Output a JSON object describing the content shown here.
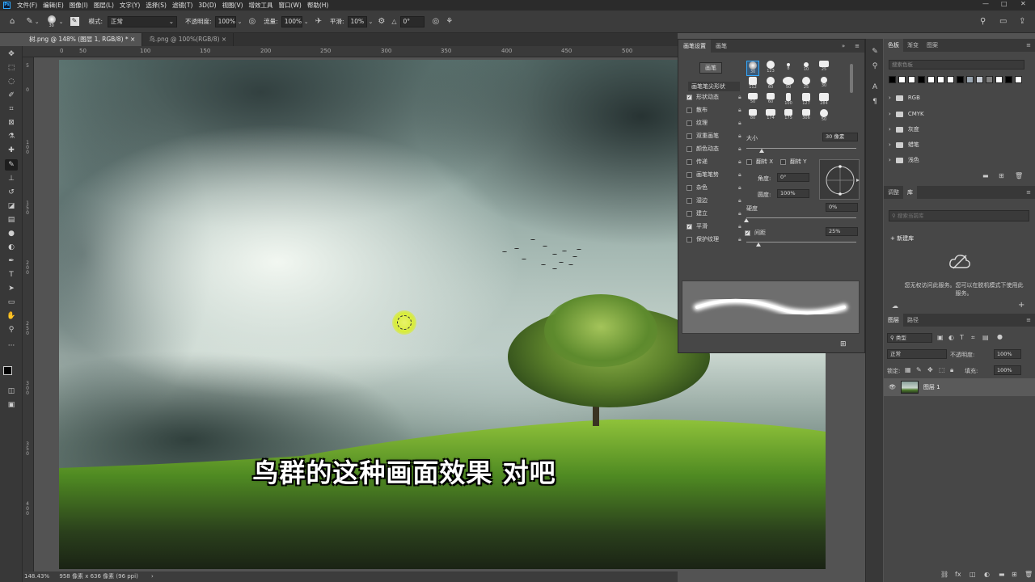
{
  "app": {
    "logo": "Ps"
  },
  "menu": [
    "文件(F)",
    "编辑(E)",
    "图像(I)",
    "图层(L)",
    "文字(Y)",
    "选择(S)",
    "滤镜(T)",
    "3D(D)",
    "视图(V)",
    "增效工具",
    "窗口(W)",
    "帮助(H)"
  ],
  "window_controls": {
    "min": "—",
    "max": "□",
    "close": "✕"
  },
  "options": {
    "brush_size": "30",
    "mode_label": "模式:",
    "mode_value": "正常",
    "opacity_label": "不透明度:",
    "opacity_value": "100%",
    "flow_label": "流量:",
    "flow_value": "100%",
    "smooth_label": "平滑:",
    "smooth_value": "10%",
    "angle_icon": "△",
    "angle_value": "0°"
  },
  "tabs": [
    {
      "label": "树.png @ 148% (图层 1, RGB/8) *",
      "close": "×"
    },
    {
      "label": "鸟.png @ 100%(RGB/8)",
      "close": "×"
    }
  ],
  "ruler_h": [
    "0",
    "50",
    "100",
    "150",
    "200",
    "250",
    "300",
    "350",
    "400",
    "450",
    "500",
    "550",
    "600",
    "650",
    "700",
    "750"
  ],
  "ruler_v": [
    "5",
    "0",
    "1\n0\n0",
    "1\n5\n0",
    "2\n0\n0",
    "2\n5\n0",
    "3\n0\n0",
    "3\n5\n0",
    "4\n0\n0",
    "4\n5\n0",
    "5\n0\n0",
    "5\n5\n0",
    "6\n0\n0"
  ],
  "canvas": {
    "subtitle": "鸟群的这种画面效果 对吧"
  },
  "status": {
    "zoom": "148.43%",
    "doc_info": "958 像素 x 636 像素 (96 ppi)",
    "arrow": "›"
  },
  "tools": [
    "move-icon",
    "artboard-icon",
    "lasso-icon",
    "quick-select-icon",
    "crop-icon",
    "frame-icon",
    "eyedropper-icon",
    "healing-icon",
    "brush-icon",
    "stamp-icon",
    "history-brush-icon",
    "eraser-icon",
    "gradient-icon",
    "blur-icon",
    "dodge-icon",
    "pen-icon",
    "type-icon",
    "path-select-icon",
    "shape-icon",
    "hand-icon",
    "zoom-icon",
    "more-icon"
  ],
  "brush_panel": {
    "tab1": "画笔设置",
    "tab2": "画笔",
    "menu": "≡",
    "collapse": "»",
    "brushes_button": "画笔",
    "tip_shape": "画笔笔尖形状",
    "options": [
      {
        "label": "形状动态",
        "checked": true
      },
      {
        "label": "散布",
        "checked": false
      },
      {
        "label": "纹理",
        "checked": false
      },
      {
        "label": "双重画笔",
        "checked": false
      },
      {
        "label": "颜色动态",
        "checked": false
      },
      {
        "label": "传递",
        "checked": false
      },
      {
        "label": "画笔笔势",
        "checked": false
      },
      {
        "label": "杂色",
        "checked": false
      },
      {
        "label": "湿边",
        "checked": false
      },
      {
        "label": "建立",
        "checked": false
      },
      {
        "label": "平滑",
        "checked": true
      },
      {
        "label": "保护纹理",
        "checked": false
      }
    ],
    "presets": [
      "30",
      "123",
      "8",
      "10",
      "25",
      "112",
      "60",
      "50",
      "25",
      "30",
      "50",
      "60",
      "100",
      "127",
      "284",
      "80",
      "174",
      "175",
      "306",
      "50"
    ],
    "size_label": "大小",
    "size_value": "30 像素",
    "flipx": "翻转 X",
    "flipy": "翻转 Y",
    "angle_label": "角度:",
    "angle_value": "0°",
    "round_label": "圆度:",
    "round_value": "100%",
    "hardness_label": "硬度",
    "hardness_value": "0%",
    "spacing_label": "间距",
    "spacing_value": "25%",
    "spacing_checked": true,
    "new_icon": "⊞"
  },
  "swatches_panel": {
    "tabs": [
      "色板",
      "渐变",
      "图案"
    ],
    "search_placeholder": "搜索色板",
    "colors": [
      "#000000",
      "#ffffff",
      "#ffffff",
      "#000000",
      "#ffffff",
      "#ffffff",
      "#ffffff",
      "#000000",
      "#9aa6b2",
      "#c9ced6",
      "#808080",
      "#ffffff",
      "#000000",
      "#ffffff"
    ],
    "groups": [
      "RGB",
      "CMYK",
      "灰度",
      "蜡笔",
      "浅色"
    ]
  },
  "library_panel": {
    "tabs": [
      "调整",
      "库"
    ],
    "search_placeholder": "搜索当前库",
    "new_library": "新建库",
    "message": "您无权访问此服务。您可以在脱机模式下使用此服务。"
  },
  "layers_panel": {
    "tabs": [
      "图层",
      "路径"
    ],
    "filter": "类型",
    "blend": "正常",
    "opacity_label": "不透明度:",
    "opacity_value": "100%",
    "lock_label": "锁定:",
    "fill_label": "填充:",
    "fill_value": "100%",
    "layer_name": "图层 1"
  }
}
